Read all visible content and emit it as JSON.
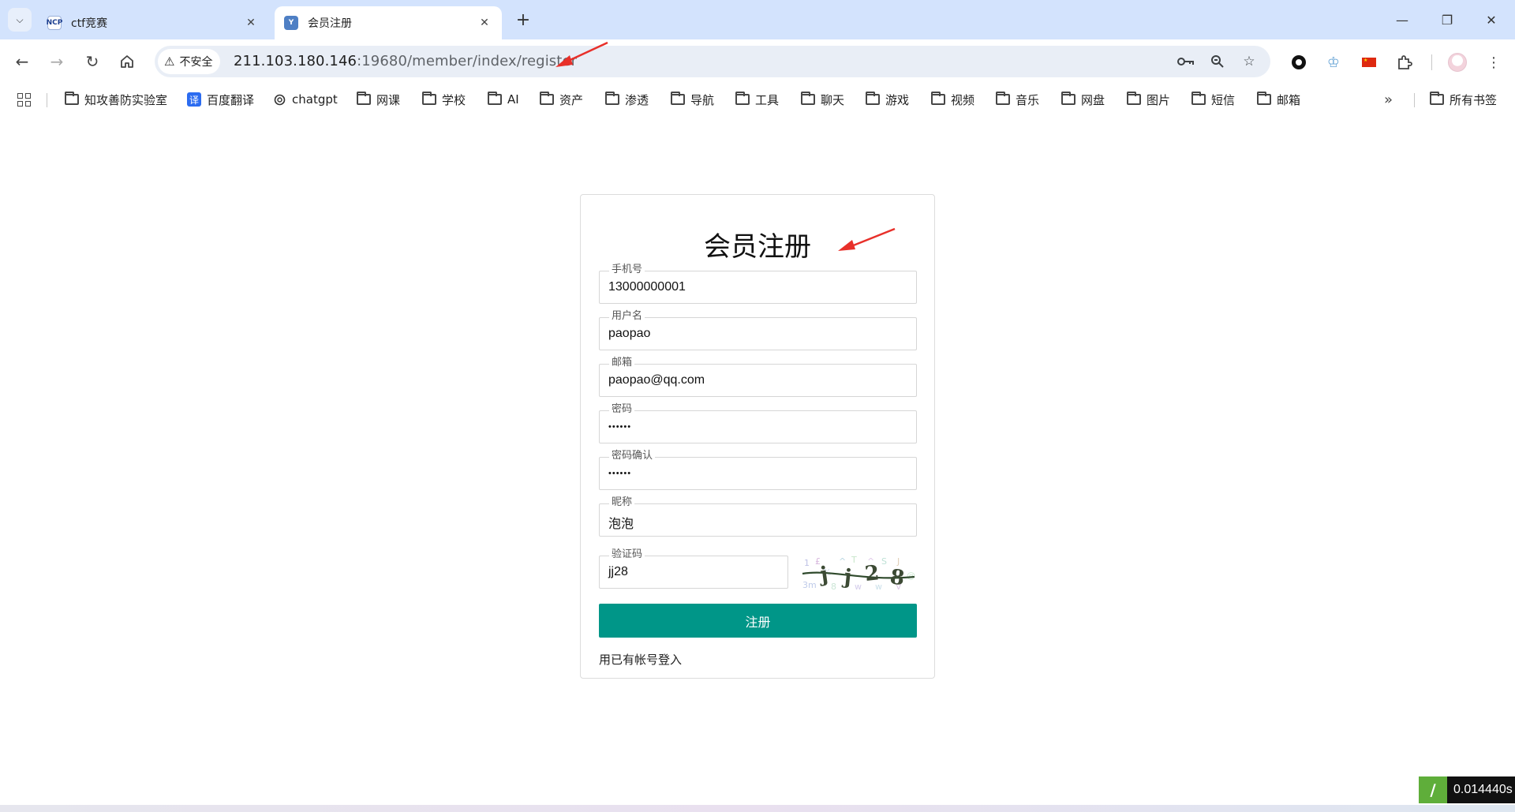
{
  "browser": {
    "tabs": [
      {
        "title": "ctf竞赛",
        "favicon": "NCP"
      },
      {
        "title": "会员注册",
        "favicon": "Y"
      }
    ],
    "address": {
      "security_label": "不安全",
      "url_host": "211.103.180.146",
      "url_rest": ":19680/member/index/register"
    },
    "bookmarks": [
      {
        "label": "知攻善防实验室",
        "icon": "folder-icon"
      },
      {
        "label": "百度翻译",
        "icon": "fanyi-icon",
        "glyph": "译"
      },
      {
        "label": "chatgpt",
        "icon": "openai-icon"
      },
      {
        "label": "网课",
        "icon": "folder-icon"
      },
      {
        "label": "学校",
        "icon": "folder-icon"
      },
      {
        "label": "AI",
        "icon": "folder-icon"
      },
      {
        "label": "资产",
        "icon": "folder-icon"
      },
      {
        "label": "渗透",
        "icon": "folder-icon"
      },
      {
        "label": "导航",
        "icon": "folder-icon"
      },
      {
        "label": "工具",
        "icon": "folder-icon"
      },
      {
        "label": "聊天",
        "icon": "folder-icon"
      },
      {
        "label": "游戏",
        "icon": "folder-icon"
      },
      {
        "label": "视频",
        "icon": "folder-icon"
      },
      {
        "label": "音乐",
        "icon": "folder-icon"
      },
      {
        "label": "网盘",
        "icon": "folder-icon"
      },
      {
        "label": "图片",
        "icon": "folder-icon"
      },
      {
        "label": "短信",
        "icon": "folder-icon"
      },
      {
        "label": "邮箱",
        "icon": "folder-icon"
      }
    ],
    "all_bookmarks": "所有书签"
  },
  "form": {
    "title": "会员注册",
    "fields": {
      "phone": {
        "label": "手机号",
        "value": "13000000001"
      },
      "username": {
        "label": "用户名",
        "value": "paopao"
      },
      "email": {
        "label": "邮箱",
        "value": "paopao@qq.com"
      },
      "password": {
        "label": "密码",
        "value": "••••••"
      },
      "password_confirm": {
        "label": "密码确认",
        "value": "••••••"
      },
      "nickname": {
        "label": "昵称",
        "value": "泡泡"
      },
      "captcha": {
        "label": "验证码",
        "value": "jj28"
      }
    },
    "submit_label": "注册",
    "login_link": "用已有帐号登入"
  },
  "overlay": {
    "timer_text": "0.014440s"
  },
  "colors": {
    "tabstrip": "#d3e3fd",
    "submit": "#009688",
    "annotation_arrow": "#e8302a"
  }
}
